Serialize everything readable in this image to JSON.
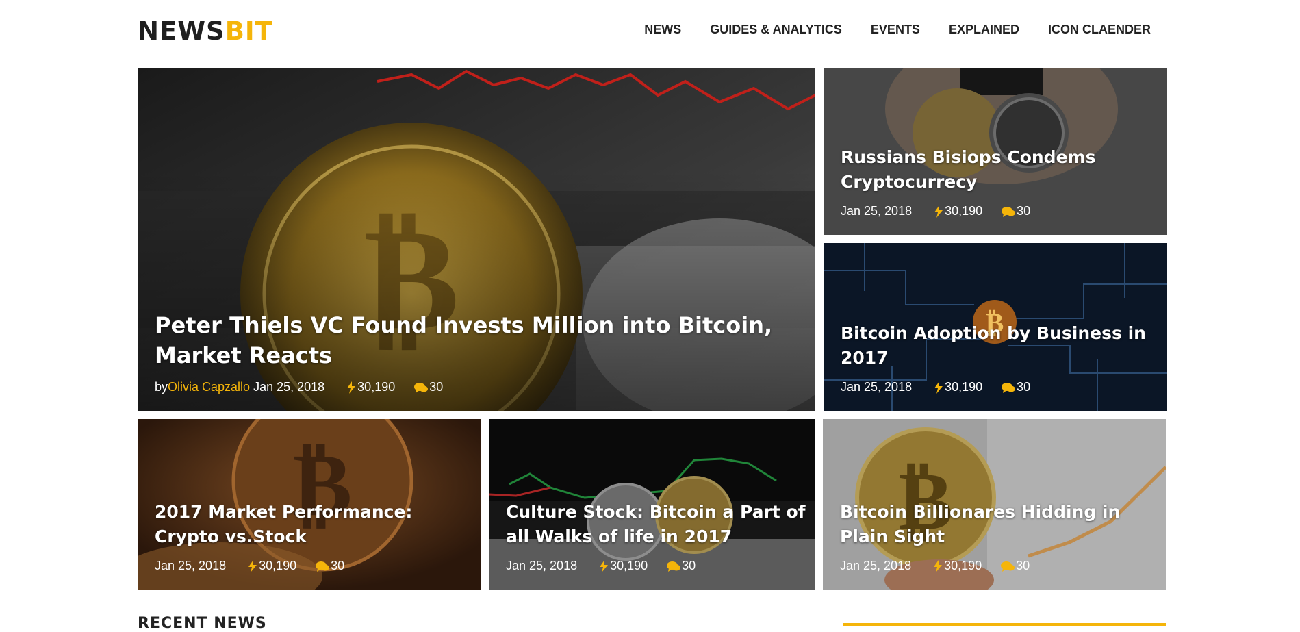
{
  "logo": {
    "part1": "NEWS",
    "part2": "BIT"
  },
  "nav": [
    "NEWS",
    "GUIDES & ANALYTICS",
    "EVENTS",
    "EXPLAINED",
    "ICON CLAENDER"
  ],
  "featured": {
    "title": "Peter Thiels VC Found Invests Million into Bitcoin, Market Reacts",
    "by": "by",
    "author": "Olivia Capzallo",
    "date": "Jan 25, 2018",
    "views": "30,190",
    "comments": "30"
  },
  "side_cards": [
    {
      "title": "Russians Bisiops Condems Cryptocurrecy",
      "date": "Jan 25, 2018",
      "views": "30,190",
      "comments": "30"
    },
    {
      "title": "Bitcoin Adoption by Business in 2017",
      "date": "Jan 25, 2018",
      "views": "30,190",
      "comments": "30"
    }
  ],
  "bottom_cards": [
    {
      "title": "2017 Market Performance: Crypto vs.Stock",
      "date": "Jan 25, 2018",
      "views": "30,190",
      "comments": "30"
    },
    {
      "title": "Culture Stock: Bitcoin a Part of all Walks of life in 2017",
      "date": "Jan 25, 2018",
      "views": "30,190",
      "comments": "30"
    },
    {
      "title": "Bitcoin Billionares Hidding in Plain Sight",
      "date": "Jan 25, 2018",
      "views": "30,190",
      "comments": "30"
    }
  ],
  "section_heading": "RECENT NEWS",
  "colors": {
    "accent": "#f5b50a",
    "text": "#222222"
  },
  "icons": {
    "views": "bolt-icon",
    "comments": "comments-icon"
  }
}
